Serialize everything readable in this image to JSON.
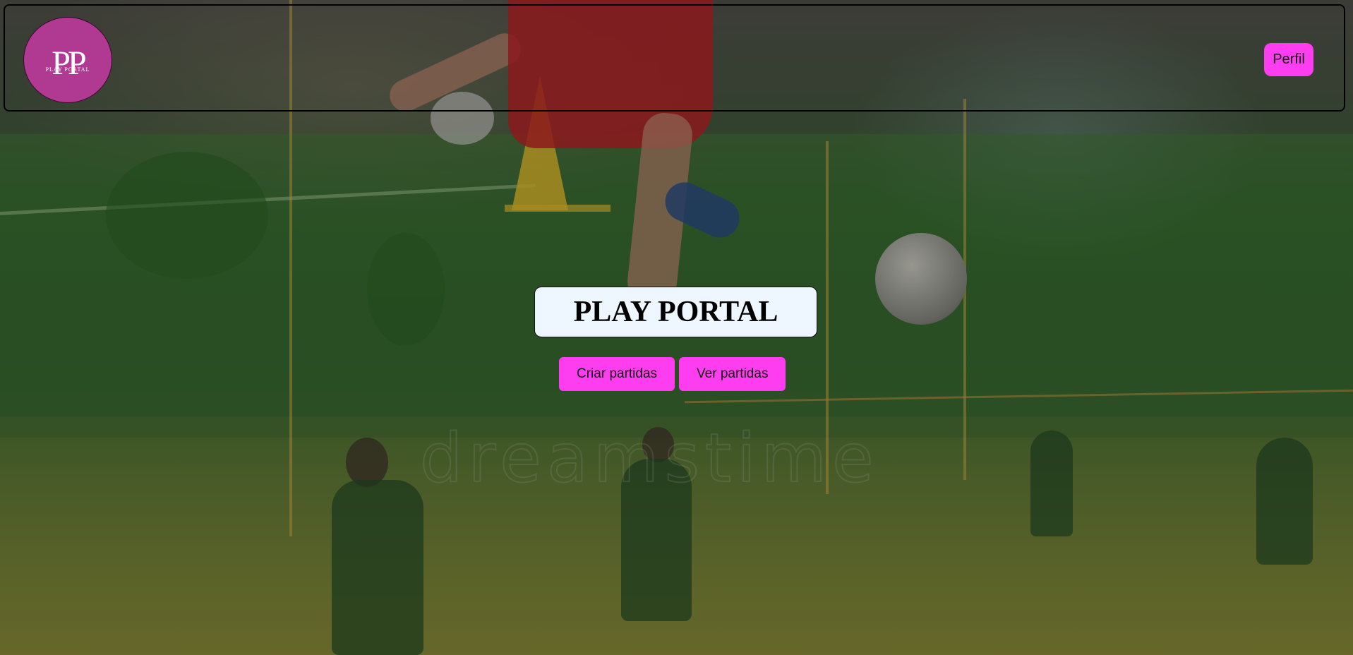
{
  "header": {
    "logo": {
      "mark": "PP",
      "sub": "PLAY PORTAL"
    },
    "profile_label": "Perfil"
  },
  "hero": {
    "title": "PLAY PORTAL",
    "create_label": "Criar partidas",
    "view_label": "Ver partidas"
  },
  "background": {
    "watermark": "dreamstime"
  },
  "colors": {
    "accent": "#ff3df0",
    "logo_bg": "#b03a92",
    "title_bg": "#eef6ff"
  }
}
